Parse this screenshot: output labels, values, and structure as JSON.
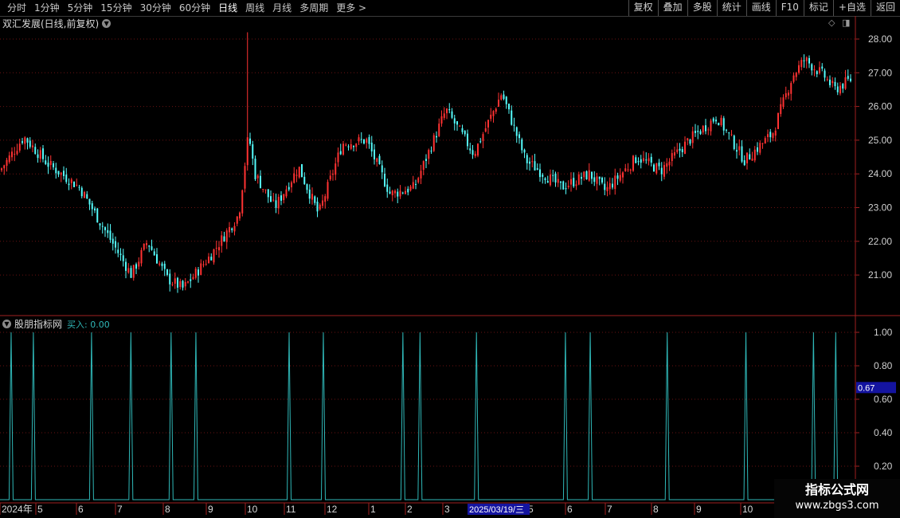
{
  "toolbar": {
    "periods": [
      "分时",
      "1分钟",
      "5分钟",
      "15分钟",
      "30分钟",
      "60分钟",
      "日线",
      "周线",
      "月线",
      "多周期",
      "更多 >"
    ],
    "active_period": "日线",
    "actions": [
      "复权",
      "叠加",
      "多股",
      "统计",
      "画线",
      "F10",
      "标记",
      "+自选",
      "返回"
    ]
  },
  "chart": {
    "title": "双汇发展(日线,前复权)",
    "price_ticks": [
      "28.00",
      "27.00",
      "26.00",
      "25.00",
      "24.00",
      "23.00",
      "22.00",
      "21.00"
    ],
    "up_color": "#ff3232",
    "down_color": "#54fcfc"
  },
  "indicator": {
    "name": "股朋指标网",
    "value_label": "买入: 0.00",
    "ticks": [
      "1.00",
      "0.80",
      "0.60",
      "0.40",
      "0.20"
    ],
    "highlight_value": "0.67",
    "line_color": "#2fb8b8"
  },
  "xaxis": {
    "labels": [
      "2024年",
      "5",
      "6",
      "7",
      "8",
      "9",
      "10",
      "11",
      "12",
      "1",
      "2",
      "3",
      "5",
      "6",
      "7",
      "8",
      "9",
      "10"
    ],
    "cursor_date": "2025/03/19/三"
  },
  "watermark": {
    "title": "指标公式网",
    "url": "www.zbgs3.com"
  },
  "chart_data": {
    "type": "line",
    "title": "股朋指标网",
    "ylim": [
      0,
      1
    ],
    "series": [
      {
        "name": "买入",
        "values": [
          0,
          1,
          0,
          1,
          0,
          1,
          0,
          1,
          0,
          1,
          0,
          1,
          0,
          1,
          0,
          1,
          0,
          1,
          0,
          1,
          0,
          1,
          0,
          1,
          0,
          1,
          0,
          1,
          0,
          1,
          0,
          1,
          0,
          1,
          0,
          1,
          0,
          1,
          0
        ]
      }
    ],
    "pulse_x_norm": [
      0.013,
      0.039,
      0.107,
      0.153,
      0.2,
      0.229,
      0.338,
      0.378,
      0.471,
      0.491,
      0.557,
      0.661,
      0.69,
      0.78,
      0.872,
      0.951,
      0.977
    ],
    "price_range": [
      20.3,
      28.2
    ]
  }
}
